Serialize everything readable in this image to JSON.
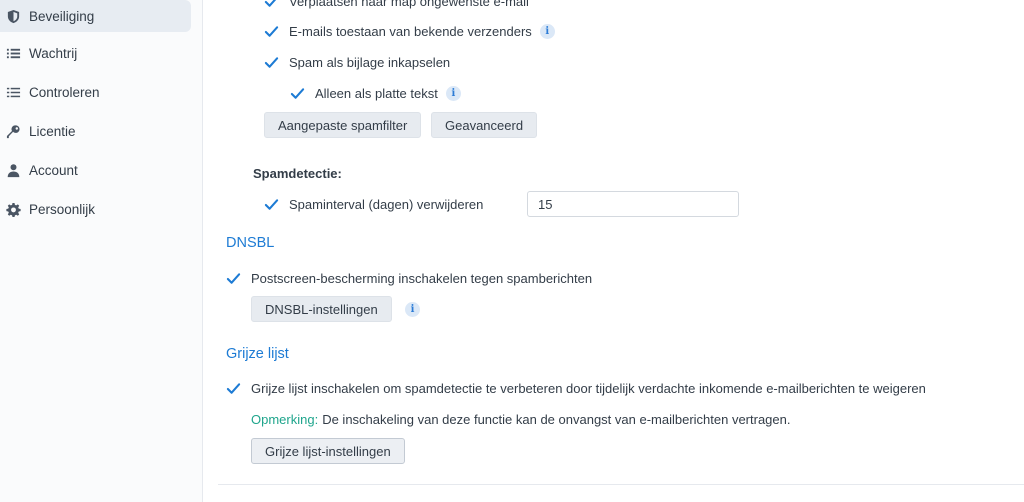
{
  "sidebar": {
    "items": [
      {
        "label": "Beveiliging",
        "icon": "shield-icon",
        "active": true
      },
      {
        "label": "Wachtrij",
        "icon": "list-icon",
        "active": false
      },
      {
        "label": "Controleren",
        "icon": "checklist-icon",
        "active": false
      },
      {
        "label": "Licentie",
        "icon": "key-icon",
        "active": false
      },
      {
        "label": "Account",
        "icon": "user-icon",
        "active": false
      },
      {
        "label": "Persoonlijk",
        "icon": "gear-icon",
        "active": false
      }
    ]
  },
  "spam": {
    "move_junk_label": "Verplaatsen naar map ongewenste e-mail",
    "allow_known_senders_label": "E-mails toestaan van bekende verzenders",
    "encapsulate_label": "Spam als bijlage inkapselen",
    "plain_text_label": "Alleen als platte tekst",
    "custom_filter_button": "Aangepaste spamfilter",
    "advanced_button": "Geavanceerd",
    "detection_heading": "Spamdetectie:",
    "interval_label": "Spaminterval (dagen) verwijderen",
    "interval_value": "15"
  },
  "dnsbl": {
    "title": "DNSBL",
    "postscreen_label": "Postscreen-bescherming inschakelen tegen spamberichten",
    "settings_button": "DNSBL-instellingen"
  },
  "greylist": {
    "title": "Grijze lijst",
    "enable_label": "Grijze lijst inschakelen om spamdetectie te verbeteren door tijdelijk verdachte inkomende e-mailberichten te weigeren",
    "note_key": "Opmerking:",
    "note_text": "De inschakeling van deze functie kan de onvangst van e-mailberichten vertragen.",
    "settings_button": "Grijze lijst-instellingen"
  },
  "colors": {
    "accent": "#1d7bd4",
    "check": "#1d7bd4",
    "note": "#1fa58c"
  },
  "info_glyph": "i"
}
